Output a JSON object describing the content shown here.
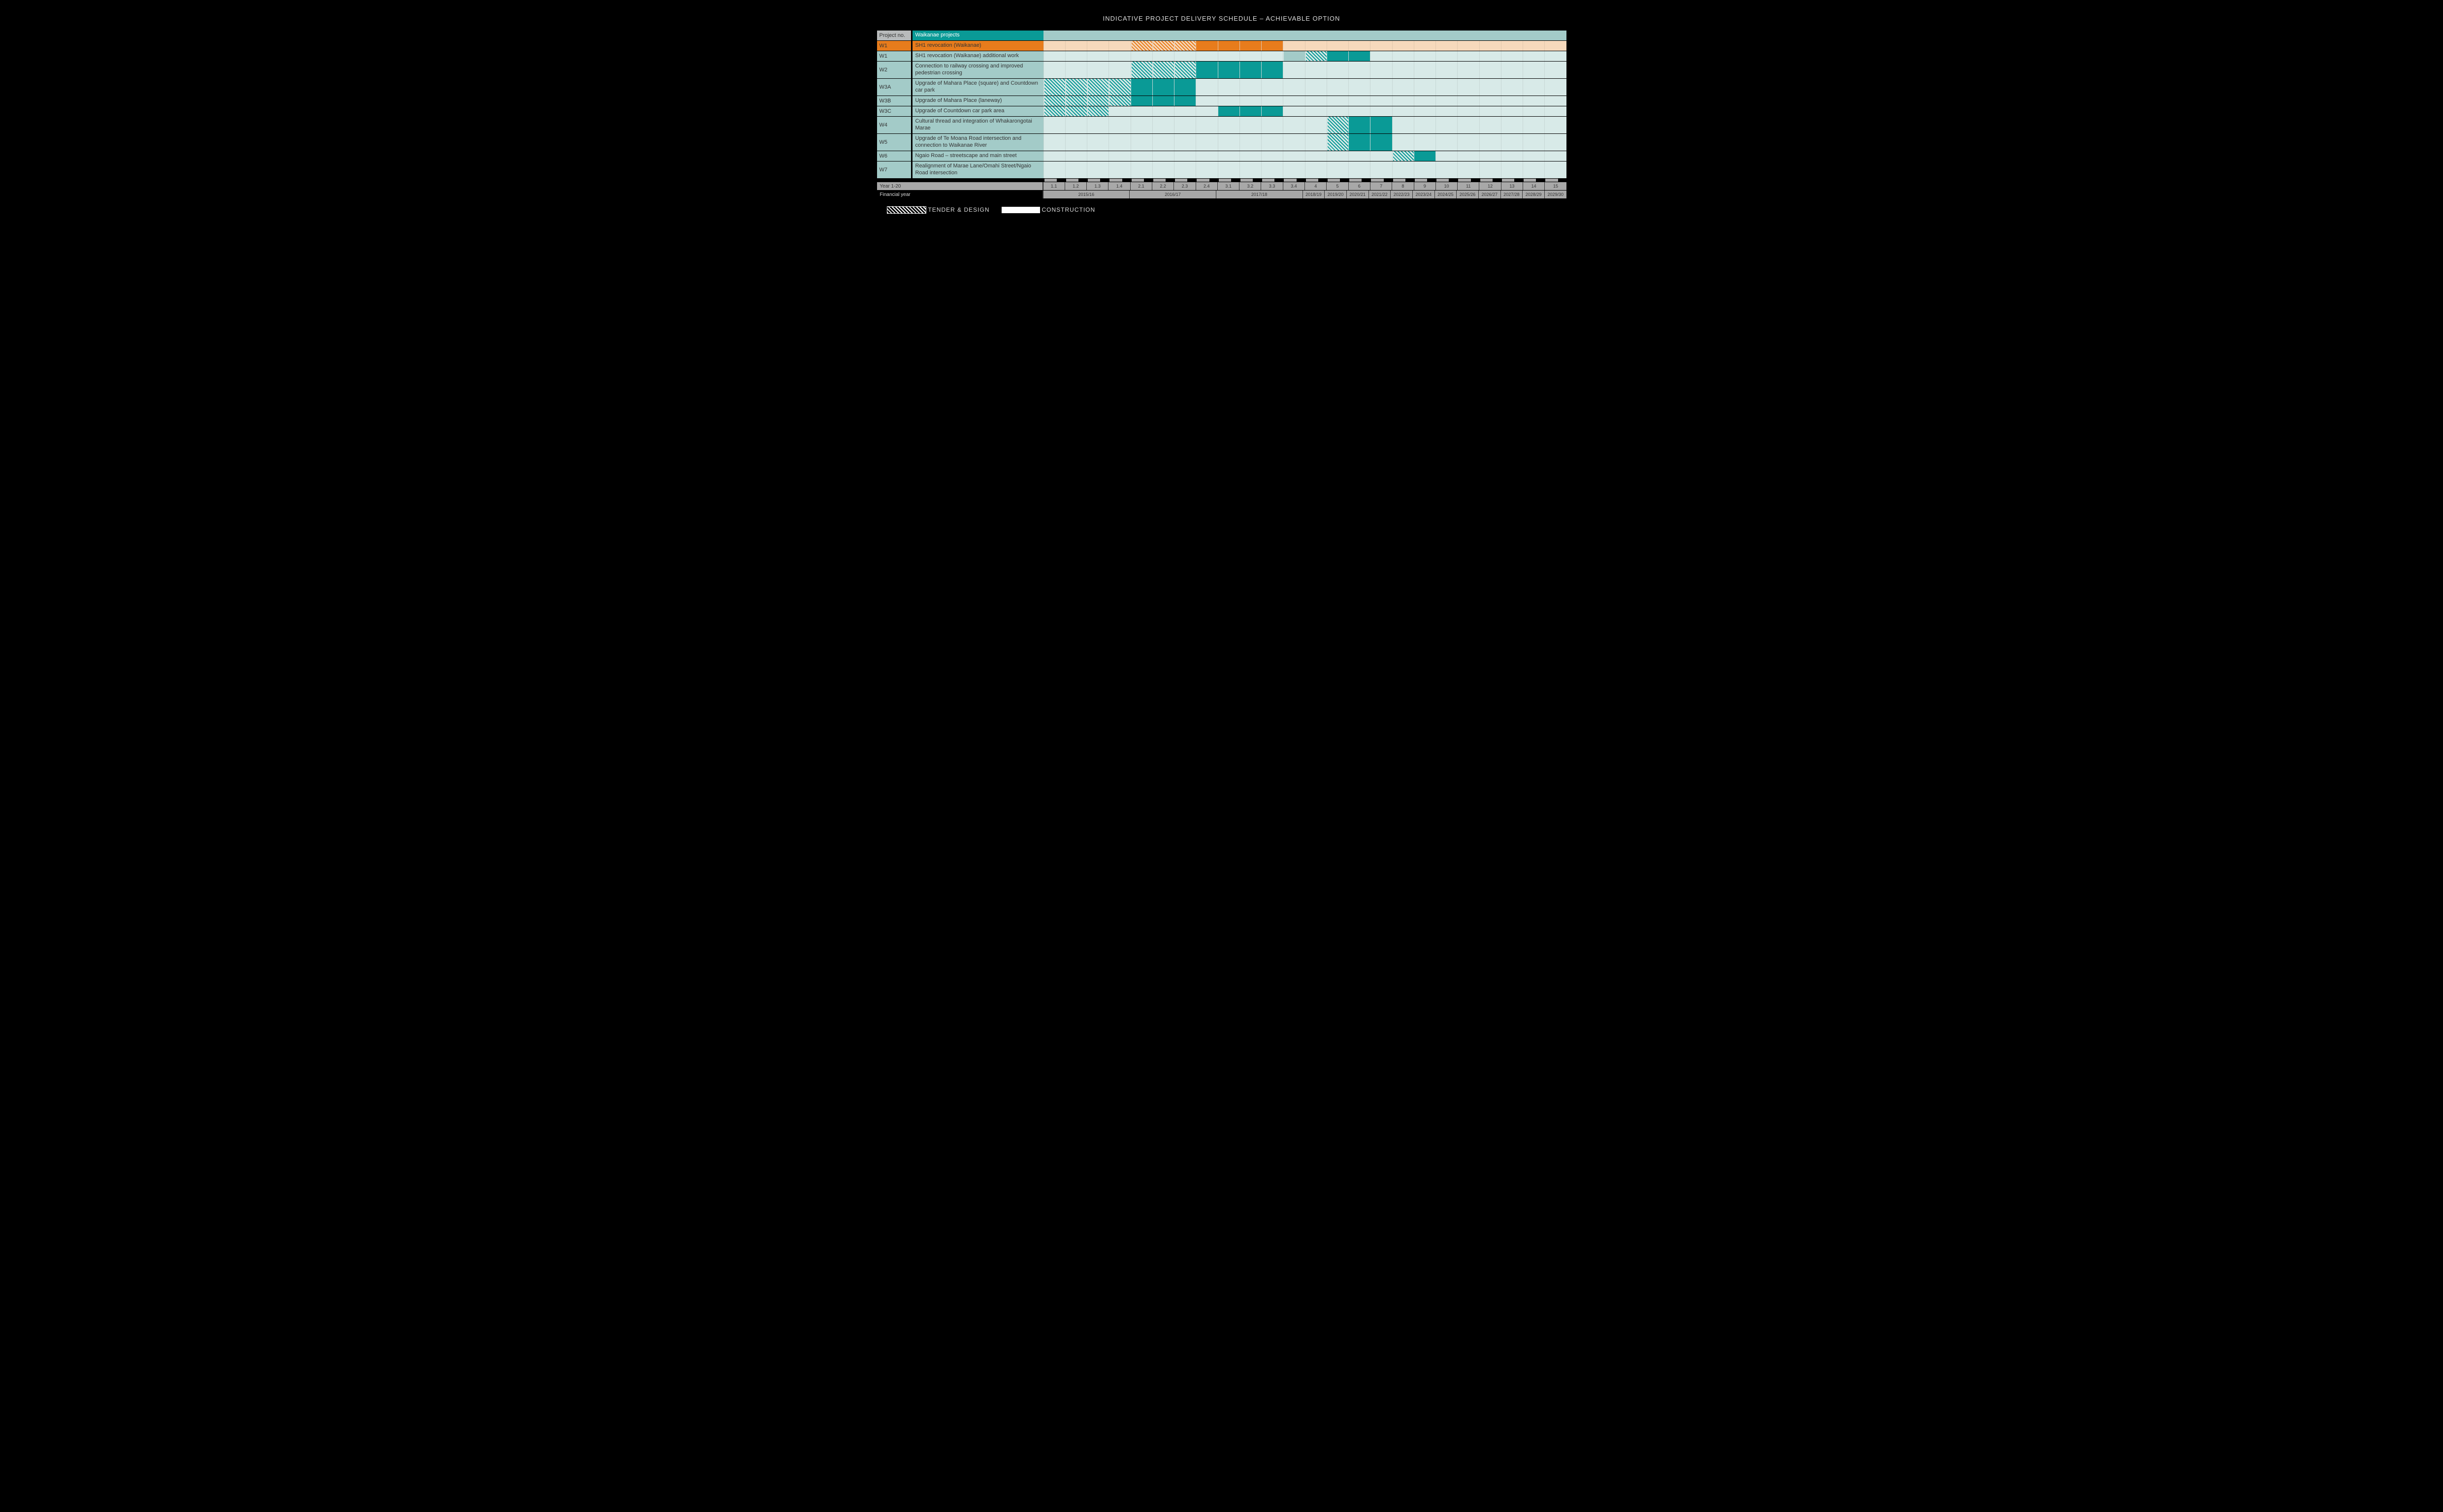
{
  "title": "INDICATIVE PROJECT DELIVERY SCHEDULE – ACHIEVABLE OPTION",
  "header": {
    "projectNoLabel": "Project no.",
    "projectGroupLabel": "Waikanae projects"
  },
  "axis": {
    "year_label": "Year 1-20",
    "fy_label": "Financial year"
  },
  "legend": {
    "tender": "TENDER & DESIGN",
    "construction": "CONSTRUCTION"
  },
  "chart_data": {
    "type": "gantt",
    "time_columns_count": 24,
    "time_column_labels": [
      "1.1",
      "1.2",
      "1.3",
      "1.4",
      "2.1",
      "2.2",
      "2.3",
      "2.4",
      "3.1",
      "3.2",
      "3.3",
      "3.4",
      "4",
      "5",
      "6",
      "7",
      "8",
      "9",
      "10",
      "11",
      "12",
      "13",
      "14",
      "15"
    ],
    "fy_groups": [
      {
        "label": "2015/16",
        "span": [
          1,
          4
        ]
      },
      {
        "label": "2016/17",
        "span": [
          5,
          8
        ]
      },
      {
        "label": "2017/18",
        "span": [
          9,
          12
        ]
      },
      {
        "label": "2018/19",
        "span": [
          13,
          13
        ]
      },
      {
        "label": "2019/20",
        "span": [
          14,
          14
        ]
      },
      {
        "label": "2020/21",
        "span": [
          15,
          15
        ]
      },
      {
        "label": "2021/22",
        "span": [
          16,
          16
        ]
      },
      {
        "label": "2022/23",
        "span": [
          17,
          17
        ]
      },
      {
        "label": "2023/24",
        "span": [
          18,
          18
        ]
      },
      {
        "label": "2024/25",
        "span": [
          19,
          19
        ]
      },
      {
        "label": "2025/26",
        "span": [
          20,
          20
        ]
      },
      {
        "label": "2026/27",
        "span": [
          21,
          21
        ]
      },
      {
        "label": "2027/28",
        "span": [
          22,
          22
        ]
      },
      {
        "label": "2028/29",
        "span": [
          23,
          23
        ]
      },
      {
        "label": "2029/30",
        "span": [
          24,
          24
        ]
      }
    ],
    "rows": [
      {
        "id": "W1",
        "name": "SH1 revocation (Waikanae)",
        "orange": true,
        "row_bg": "orange",
        "tall": false,
        "tender": [
          5,
          7
        ],
        "construction": [
          8,
          11
        ]
      },
      {
        "id": "W1",
        "name": "SH1 revocation (Waikanae) additional work",
        "orange": false,
        "tall": false,
        "prep": [
          12,
          12
        ],
        "tender": [
          13,
          13
        ],
        "construction": [
          14,
          15
        ]
      },
      {
        "id": "W2",
        "name": "Connection to railway crossing and improved pedestrian crossing",
        "tall": true,
        "tender": [
          5,
          7
        ],
        "construction": [
          8,
          11
        ]
      },
      {
        "id": "W3A",
        "name": "Upgrade of Mahara Place (square) and Countdown car park",
        "tall": true,
        "tender": [
          1,
          4
        ],
        "construction": [
          5,
          7
        ]
      },
      {
        "id": "W3B",
        "name": "Upgrade of Mahara Place (laneway)",
        "tall": false,
        "tender": [
          1,
          4
        ],
        "construction": [
          5,
          7
        ]
      },
      {
        "id": "W3C",
        "name": "Upgrade of Countdown car park area",
        "tall": false,
        "tender": [
          1,
          3
        ],
        "construction": [
          9,
          11
        ]
      },
      {
        "id": "W4",
        "name": "Cultural thread and integration of Whakarongotai Marae",
        "tall": true,
        "tender": [
          14,
          14
        ],
        "construction": [
          15,
          16
        ]
      },
      {
        "id": "W5",
        "name": "Upgrade of Te Moana Road intersection and connection to Waikanae River",
        "tall": true,
        "tender": [
          14,
          14
        ],
        "construction": [
          15,
          16
        ]
      },
      {
        "id": "W6",
        "name": "Ngaio Road – streetscape and main street",
        "tall": false,
        "tender": [
          17,
          17
        ],
        "construction": [
          18,
          18
        ]
      },
      {
        "id": "W7",
        "name": "Realignment of Marae Lane/Omahi Street/Ngaio Road intersection",
        "tall": true
      }
    ]
  }
}
